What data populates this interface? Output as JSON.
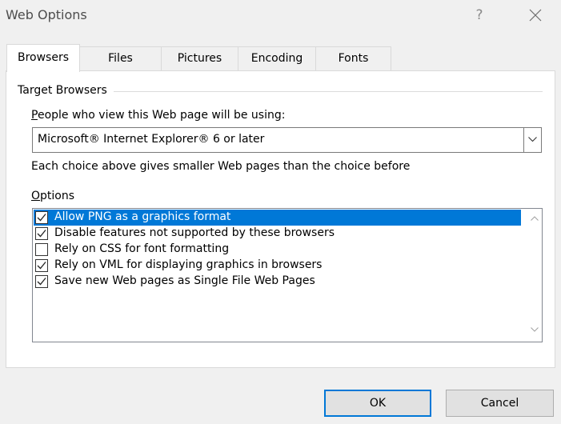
{
  "window": {
    "title": "Web Options",
    "help_label": "?"
  },
  "tabs": [
    {
      "label": "Browsers",
      "active": true
    },
    {
      "label": "Files",
      "active": false
    },
    {
      "label": "Pictures",
      "active": false
    },
    {
      "label": "Encoding",
      "active": false
    },
    {
      "label": "Fonts",
      "active": false
    }
  ],
  "target_browsers": {
    "group_title": "Target Browsers",
    "people_label_accel": "P",
    "people_label_rest": "eople who view this Web page will be using:",
    "selected_value": "Microsoft® Internet Explorer® 6 or later",
    "info_text": "Each choice above gives smaller Web pages than the choice before"
  },
  "options": {
    "label_accel": "O",
    "label_rest": "ptions",
    "items": [
      {
        "label": "Allow PNG as a graphics format",
        "checked": true,
        "selected": true
      },
      {
        "label": "Disable features not supported by these browsers",
        "checked": true,
        "selected": false
      },
      {
        "label": "Rely on CSS for font formatting",
        "checked": false,
        "selected": false
      },
      {
        "label": "Rely on VML for displaying graphics in browsers",
        "checked": true,
        "selected": false
      },
      {
        "label": "Save new Web pages as Single File Web Pages",
        "checked": true,
        "selected": false
      }
    ]
  },
  "buttons": {
    "ok": "OK",
    "cancel": "Cancel"
  },
  "colors": {
    "selection": "#0078d7",
    "dialog_bg": "#f0f0f0"
  },
  "icons": {
    "close": "close-icon",
    "dropdown": "chevron-down-icon",
    "check": "checkmark-icon"
  }
}
